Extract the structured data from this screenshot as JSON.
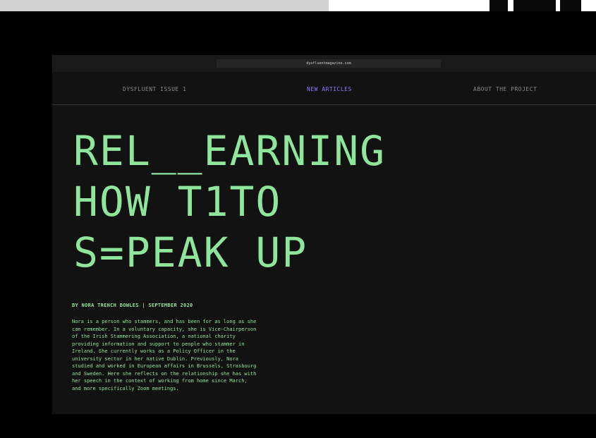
{
  "browser": {
    "url": "dysfluentmagazine.com"
  },
  "nav": {
    "issue": "DYSFLUENT ISSUE 1",
    "new_articles": "NEW ARTICLES",
    "about": "ABOUT THE PROJECT"
  },
  "article": {
    "title_lines": [
      "REL__EARNING",
      "HOW T1TO",
      "S=PEAK UP"
    ],
    "byline": "BY NORA TRENCH BOWLES | SEPTEMBER 2020",
    "bio": "Nora is a person who stammers, and has been for as long as she\ncan remember. In a voluntary capacity, she is Vice-Chairperson\nof the Irish Stammering Association, a national charity\nproviding information and support to people who stammer in\nIreland. She currently works as a Policy Officer in the\nuniversity sector in her native Dublin. Previously, Nora\nstudied and worked in European affairs in Brussels, Strasbourg\nand Sweden. Here she reflects on the relationship she has with\nher speech in the context of working from home since March,\nand more specifically Zoom meetings."
  },
  "colors": {
    "accent_green": "#8fe59b",
    "link_purple": "#8b7bff",
    "background": "#121212"
  }
}
